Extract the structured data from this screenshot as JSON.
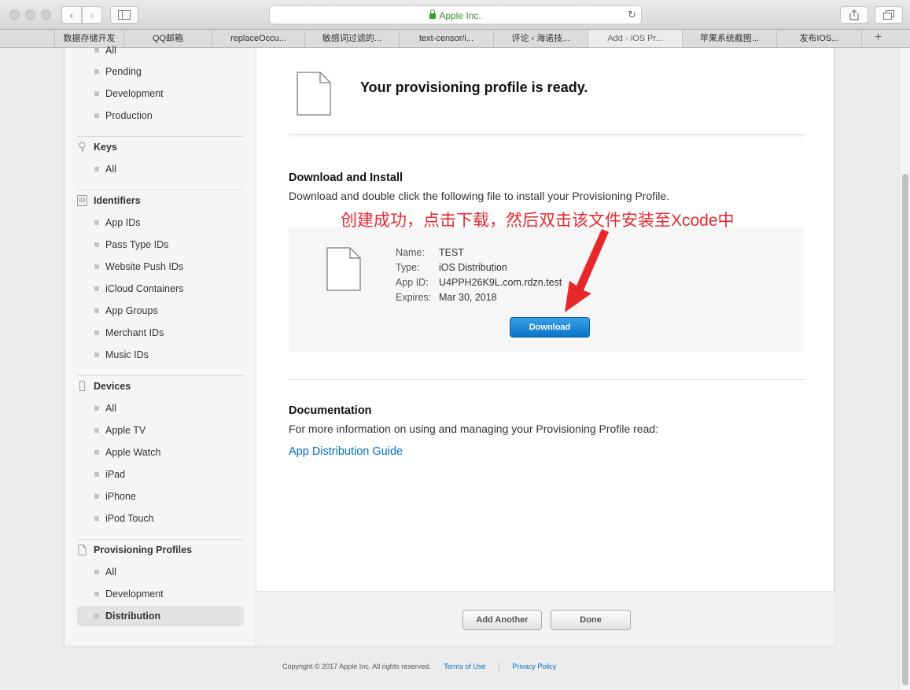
{
  "browser": {
    "address_text": "Apple Inc.",
    "tabs": [
      "",
      "数据存储开发",
      "QQ邮箱",
      "replaceOccu...",
      "敏感词过滤的...",
      "text-censor/i...",
      "评论 ‹ 海诺技...",
      "Add - iOS Pr...",
      "苹果系统截图...",
      "发布IOS...",
      "+"
    ],
    "active_tab_index": 7
  },
  "sidebar": {
    "certificates_items": [
      "All",
      "Pending",
      "Development",
      "Production"
    ],
    "keys": {
      "heading": "Keys",
      "items": [
        "All"
      ]
    },
    "identifiers": {
      "heading": "Identifiers",
      "icon_label": "ID",
      "items": [
        "App IDs",
        "Pass Type IDs",
        "Website Push IDs",
        "iCloud Containers",
        "App Groups",
        "Merchant IDs",
        "Music IDs"
      ]
    },
    "devices": {
      "heading": "Devices",
      "items": [
        "All",
        "Apple TV",
        "Apple Watch",
        "iPad",
        "iPhone",
        "iPod Touch"
      ]
    },
    "profiles": {
      "heading": "Provisioning Profiles",
      "items": [
        "All",
        "Development",
        "Distribution"
      ],
      "selected": "Distribution"
    }
  },
  "main": {
    "ready_title": "Your provisioning profile is ready.",
    "download_heading": "Download and Install",
    "download_desc": "Download and double click the following file to install your Provisioning Profile.",
    "annotation": "创建成功，点击下载，然后双击该文件安装至Xcode中",
    "profile": {
      "name_label": "Name:",
      "name": "TEST",
      "type_label": "Type:",
      "type": "iOS Distribution",
      "appid_label": "App ID:",
      "appid": "U4PPH26K9L.com.rdzn.test",
      "expires_label": "Expires:",
      "expires": "Mar 30, 2018"
    },
    "download_button": "Download",
    "doc_heading": "Documentation",
    "doc_desc": "For more information on using and managing your Provisioning Profile read:",
    "doc_link": "App Distribution Guide",
    "add_another_button": "Add Another",
    "done_button": "Done"
  },
  "footer": {
    "copyright": "Copyright © 2017 Apple Inc. All rights reserved.",
    "terms": "Terms of Use",
    "privacy": "Privacy Policy"
  },
  "colors": {
    "annotation_red": "#e8272d",
    "link_blue": "#0070c9",
    "download_blue": "#0a74c8",
    "lock_green": "#3c9d2f"
  }
}
